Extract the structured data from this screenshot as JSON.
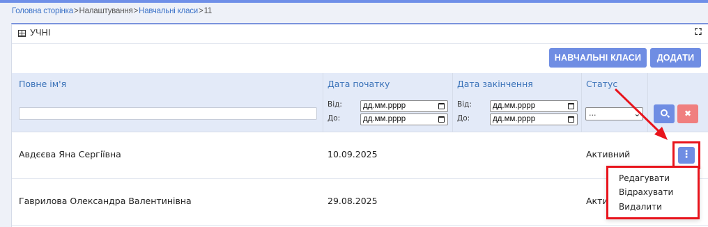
{
  "breadcrumb": {
    "home": "Головна сторінка",
    "settings": "Налаштування",
    "classes": "Навчальні класи",
    "current": "11",
    "separator": ">"
  },
  "panel": {
    "title": "УЧНІ",
    "title_icon": "grid-icon",
    "expand_icon": "expand-icon"
  },
  "toolbar": {
    "classes_label": "НАВЧАЛЬНІ КЛАСИ",
    "add_label": "ДОДАТИ"
  },
  "table": {
    "columns": [
      "Повне ім'я",
      "Дата початку",
      "Дата закінчення",
      "Статус"
    ],
    "filters": {
      "from_label": "Від:",
      "to_label": "До:",
      "date_placeholder": "дд.мм.рррр",
      "status_selected": "...",
      "name_value": ""
    },
    "rows": [
      {
        "name": "Авдєєва Яна Сергіївна",
        "start": "10.09.2025",
        "end": "",
        "status": "Активний"
      },
      {
        "name": "Гаврилова Олександра Валентинівна",
        "start": "29.08.2025",
        "end": "",
        "status": "Акти"
      }
    ]
  },
  "row_menu": {
    "items": [
      "Редагувати",
      "Відрахувати",
      "Видалити"
    ]
  },
  "icons": {
    "row_action": "⋮",
    "clear": "✖",
    "chevron": "⌄"
  },
  "colors": {
    "accent": "#6f8de3",
    "danger": "#f07f7f",
    "header_bg": "#e3eaf8",
    "link": "#3e74c9",
    "annotation": "#e8141c"
  }
}
